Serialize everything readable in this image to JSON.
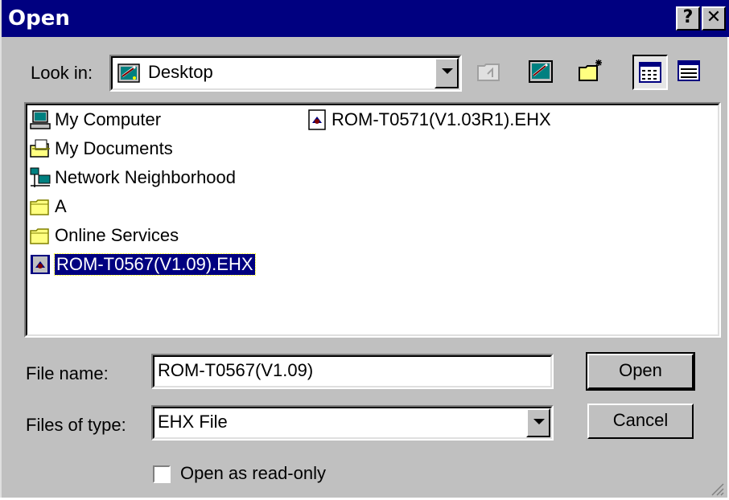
{
  "window": {
    "title": "Open",
    "help_label": "?",
    "close_label": "✕"
  },
  "toolbar": {
    "look_in_label": "Look in:",
    "look_in_value": "Desktop",
    "buttons": [
      "up-one-level",
      "go-to-desktop",
      "create-new-folder",
      "list-view",
      "details-view"
    ]
  },
  "files": {
    "items": [
      {
        "name": "My Computer",
        "icon": "my-computer-icon"
      },
      {
        "name": "My Documents",
        "icon": "my-documents-icon"
      },
      {
        "name": "Network Neighborhood",
        "icon": "network-neighborhood-icon"
      },
      {
        "name": "A",
        "icon": "folder-icon"
      },
      {
        "name": "Online Services",
        "icon": "folder-icon"
      },
      {
        "name": "ROM-T0567(V1.09).EHX",
        "icon": "ehx-file-icon",
        "selected": true
      },
      {
        "name": "ROM-T0571(V1.03R1).EHX",
        "icon": "ehx-file-icon"
      }
    ]
  },
  "form": {
    "file_name_label": "File name:",
    "file_name_value": "ROM-T0567(V1.09)",
    "file_type_label": "Files of type:",
    "file_type_value": "EHX File",
    "readonly_label": "Open as read-only",
    "readonly_checked": false
  },
  "buttons": {
    "open": "Open",
    "cancel": "Cancel"
  }
}
